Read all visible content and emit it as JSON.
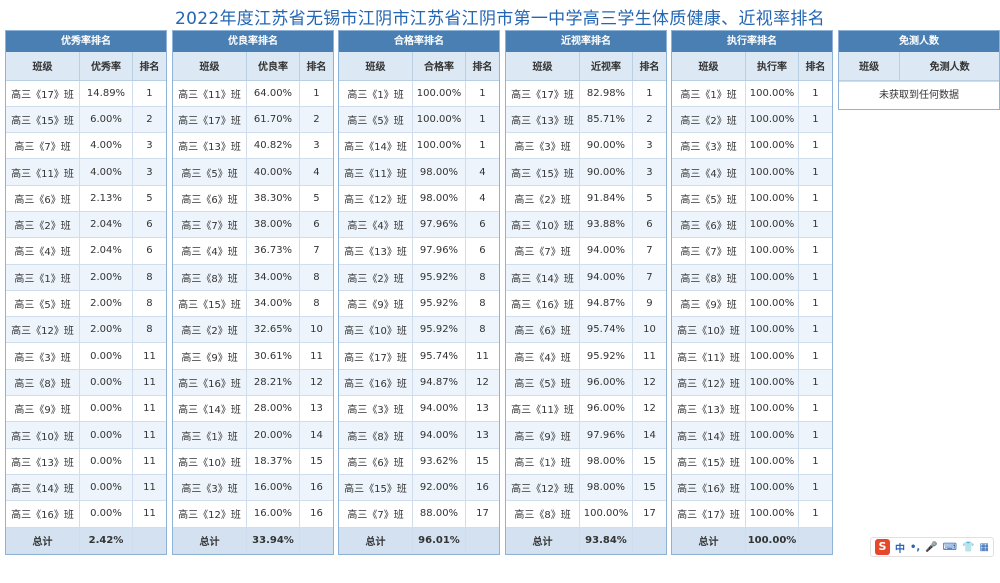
{
  "title": "2022年度江苏省无锡市江阴市江苏省江阴市第一中学高三学生体质健康、近视率排名",
  "panels": [
    {
      "title": "优秀率排名",
      "headers": [
        "班级",
        "优秀率",
        "排名"
      ],
      "rows": [
        [
          "高三《17》班",
          "14.89%",
          "1"
        ],
        [
          "高三《15》班",
          "6.00%",
          "2"
        ],
        [
          "高三《7》班",
          "4.00%",
          "3"
        ],
        [
          "高三《11》班",
          "4.00%",
          "3"
        ],
        [
          "高三《6》班",
          "2.13%",
          "5"
        ],
        [
          "高三《2》班",
          "2.04%",
          "6"
        ],
        [
          "高三《4》班",
          "2.04%",
          "6"
        ],
        [
          "高三《1》班",
          "2.00%",
          "8"
        ],
        [
          "高三《5》班",
          "2.00%",
          "8"
        ],
        [
          "高三《12》班",
          "2.00%",
          "8"
        ],
        [
          "高三《3》班",
          "0.00%",
          "11"
        ],
        [
          "高三《8》班",
          "0.00%",
          "11"
        ],
        [
          "高三《9》班",
          "0.00%",
          "11"
        ],
        [
          "高三《10》班",
          "0.00%",
          "11"
        ],
        [
          "高三《13》班",
          "0.00%",
          "11"
        ],
        [
          "高三《14》班",
          "0.00%",
          "11"
        ],
        [
          "高三《16》班",
          "0.00%",
          "11"
        ]
      ],
      "total": [
        "总计",
        "2.42%",
        ""
      ]
    },
    {
      "title": "优良率排名",
      "headers": [
        "班级",
        "优良率",
        "排名"
      ],
      "rows": [
        [
          "高三《11》班",
          "64.00%",
          "1"
        ],
        [
          "高三《17》班",
          "61.70%",
          "2"
        ],
        [
          "高三《13》班",
          "40.82%",
          "3"
        ],
        [
          "高三《5》班",
          "40.00%",
          "4"
        ],
        [
          "高三《6》班",
          "38.30%",
          "5"
        ],
        [
          "高三《7》班",
          "38.00%",
          "6"
        ],
        [
          "高三《4》班",
          "36.73%",
          "7"
        ],
        [
          "高三《8》班",
          "34.00%",
          "8"
        ],
        [
          "高三《15》班",
          "34.00%",
          "8"
        ],
        [
          "高三《2》班",
          "32.65%",
          "10"
        ],
        [
          "高三《9》班",
          "30.61%",
          "11"
        ],
        [
          "高三《16》班",
          "28.21%",
          "12"
        ],
        [
          "高三《14》班",
          "28.00%",
          "13"
        ],
        [
          "高三《1》班",
          "20.00%",
          "14"
        ],
        [
          "高三《10》班",
          "18.37%",
          "15"
        ],
        [
          "高三《3》班",
          "16.00%",
          "16"
        ],
        [
          "高三《12》班",
          "16.00%",
          "16"
        ]
      ],
      "total": [
        "总计",
        "33.94%",
        ""
      ]
    },
    {
      "title": "合格率排名",
      "headers": [
        "班级",
        "合格率",
        "排名"
      ],
      "rows": [
        [
          "高三《1》班",
          "100.00%",
          "1"
        ],
        [
          "高三《5》班",
          "100.00%",
          "1"
        ],
        [
          "高三《14》班",
          "100.00%",
          "1"
        ],
        [
          "高三《11》班",
          "98.00%",
          "4"
        ],
        [
          "高三《12》班",
          "98.00%",
          "4"
        ],
        [
          "高三《4》班",
          "97.96%",
          "6"
        ],
        [
          "高三《13》班",
          "97.96%",
          "6"
        ],
        [
          "高三《2》班",
          "95.92%",
          "8"
        ],
        [
          "高三《9》班",
          "95.92%",
          "8"
        ],
        [
          "高三《10》班",
          "95.92%",
          "8"
        ],
        [
          "高三《17》班",
          "95.74%",
          "11"
        ],
        [
          "高三《16》班",
          "94.87%",
          "12"
        ],
        [
          "高三《3》班",
          "94.00%",
          "13"
        ],
        [
          "高三《8》班",
          "94.00%",
          "13"
        ],
        [
          "高三《6》班",
          "93.62%",
          "15"
        ],
        [
          "高三《15》班",
          "92.00%",
          "16"
        ],
        [
          "高三《7》班",
          "88.00%",
          "17"
        ]
      ],
      "total": [
        "总计",
        "96.01%",
        ""
      ]
    },
    {
      "title": "近视率排名",
      "headers": [
        "班级",
        "近视率",
        "排名"
      ],
      "rows": [
        [
          "高三《17》班",
          "82.98%",
          "1"
        ],
        [
          "高三《13》班",
          "85.71%",
          "2"
        ],
        [
          "高三《3》班",
          "90.00%",
          "3"
        ],
        [
          "高三《15》班",
          "90.00%",
          "3"
        ],
        [
          "高三《2》班",
          "91.84%",
          "5"
        ],
        [
          "高三《10》班",
          "93.88%",
          "6"
        ],
        [
          "高三《7》班",
          "94.00%",
          "7"
        ],
        [
          "高三《14》班",
          "94.00%",
          "7"
        ],
        [
          "高三《16》班",
          "94.87%",
          "9"
        ],
        [
          "高三《6》班",
          "95.74%",
          "10"
        ],
        [
          "高三《4》班",
          "95.92%",
          "11"
        ],
        [
          "高三《5》班",
          "96.00%",
          "12"
        ],
        [
          "高三《11》班",
          "96.00%",
          "12"
        ],
        [
          "高三《9》班",
          "97.96%",
          "14"
        ],
        [
          "高三《1》班",
          "98.00%",
          "15"
        ],
        [
          "高三《12》班",
          "98.00%",
          "15"
        ],
        [
          "高三《8》班",
          "100.00%",
          "17"
        ]
      ],
      "total": [
        "总计",
        "93.84%",
        ""
      ]
    },
    {
      "title": "执行率排名",
      "headers": [
        "班级",
        "执行率",
        "排名"
      ],
      "rows": [
        [
          "高三《1》班",
          "100.00%",
          "1"
        ],
        [
          "高三《2》班",
          "100.00%",
          "1"
        ],
        [
          "高三《3》班",
          "100.00%",
          "1"
        ],
        [
          "高三《4》班",
          "100.00%",
          "1"
        ],
        [
          "高三《5》班",
          "100.00%",
          "1"
        ],
        [
          "高三《6》班",
          "100.00%",
          "1"
        ],
        [
          "高三《7》班",
          "100.00%",
          "1"
        ],
        [
          "高三《8》班",
          "100.00%",
          "1"
        ],
        [
          "高三《9》班",
          "100.00%",
          "1"
        ],
        [
          "高三《10》班",
          "100.00%",
          "1"
        ],
        [
          "高三《11》班",
          "100.00%",
          "1"
        ],
        [
          "高三《12》班",
          "100.00%",
          "1"
        ],
        [
          "高三《13》班",
          "100.00%",
          "1"
        ],
        [
          "高三《14》班",
          "100.00%",
          "1"
        ],
        [
          "高三《15》班",
          "100.00%",
          "1"
        ],
        [
          "高三《16》班",
          "100.00%",
          "1"
        ],
        [
          "高三《17》班",
          "100.00%",
          "1"
        ]
      ],
      "total": [
        "总计",
        "100.00%",
        ""
      ]
    }
  ],
  "exempt_panel": {
    "title": "免测人数",
    "headers": [
      "班级",
      "免测人数"
    ],
    "empty_text": "未获取到任何数据"
  },
  "ime": {
    "logo": "S",
    "items": [
      "中",
      "•,",
      "🎤",
      "⌨",
      "👕",
      "▦"
    ]
  }
}
